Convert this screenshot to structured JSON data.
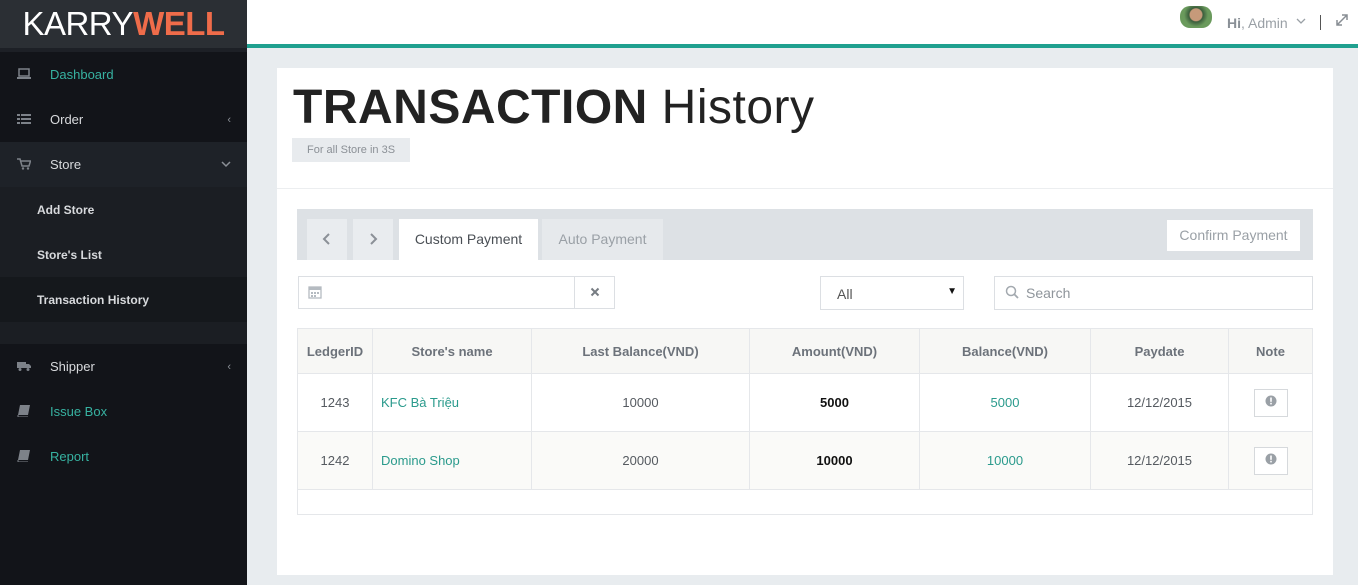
{
  "brand": {
    "part1": "KARRY",
    "part2": "WELL"
  },
  "colors": {
    "accent": "#1fa08f",
    "brand_accent": "#ef6c4a",
    "sidebar_bg": "#121419"
  },
  "sidebar": {
    "items": [
      {
        "label": "Dashboard",
        "icon": "laptop-icon"
      },
      {
        "label": "Order",
        "icon": "list-icon"
      },
      {
        "label": "Store",
        "icon": "cart-icon"
      },
      {
        "label": "Shipper",
        "icon": "truck-icon"
      },
      {
        "label": "Issue Box",
        "icon": "book-icon"
      },
      {
        "label": "Report",
        "icon": "book-icon"
      }
    ],
    "store_sub": [
      "Add Store",
      "Store's List",
      "Transaction History"
    ]
  },
  "topbar": {
    "hi": "Hi",
    "user": ", Admin"
  },
  "page": {
    "title_bold": "TRANSACTION",
    "title_light": "History",
    "subtitle": "For all Store in 3S"
  },
  "tabs": [
    "Custom Payment",
    "Auto Payment"
  ],
  "confirm_label": "Confirm Payment",
  "filter": {
    "select_value": "All",
    "search_placeholder": "Search"
  },
  "table": {
    "headers": [
      "LedgerID",
      "Store's name",
      "Last Balance(VND)",
      "Amount(VND)",
      "Balance(VND)",
      "Paydate",
      "Note"
    ],
    "rows": [
      {
        "ledger": "1243",
        "store": "KFC Bà Triệu",
        "last": "10000",
        "amount": "5000",
        "balance": "5000",
        "paydate": "12/12/2015"
      },
      {
        "ledger": "1242",
        "store": "Domino Shop",
        "last": "20000",
        "amount": "10000",
        "balance": "10000",
        "paydate": "12/12/2015"
      }
    ]
  }
}
